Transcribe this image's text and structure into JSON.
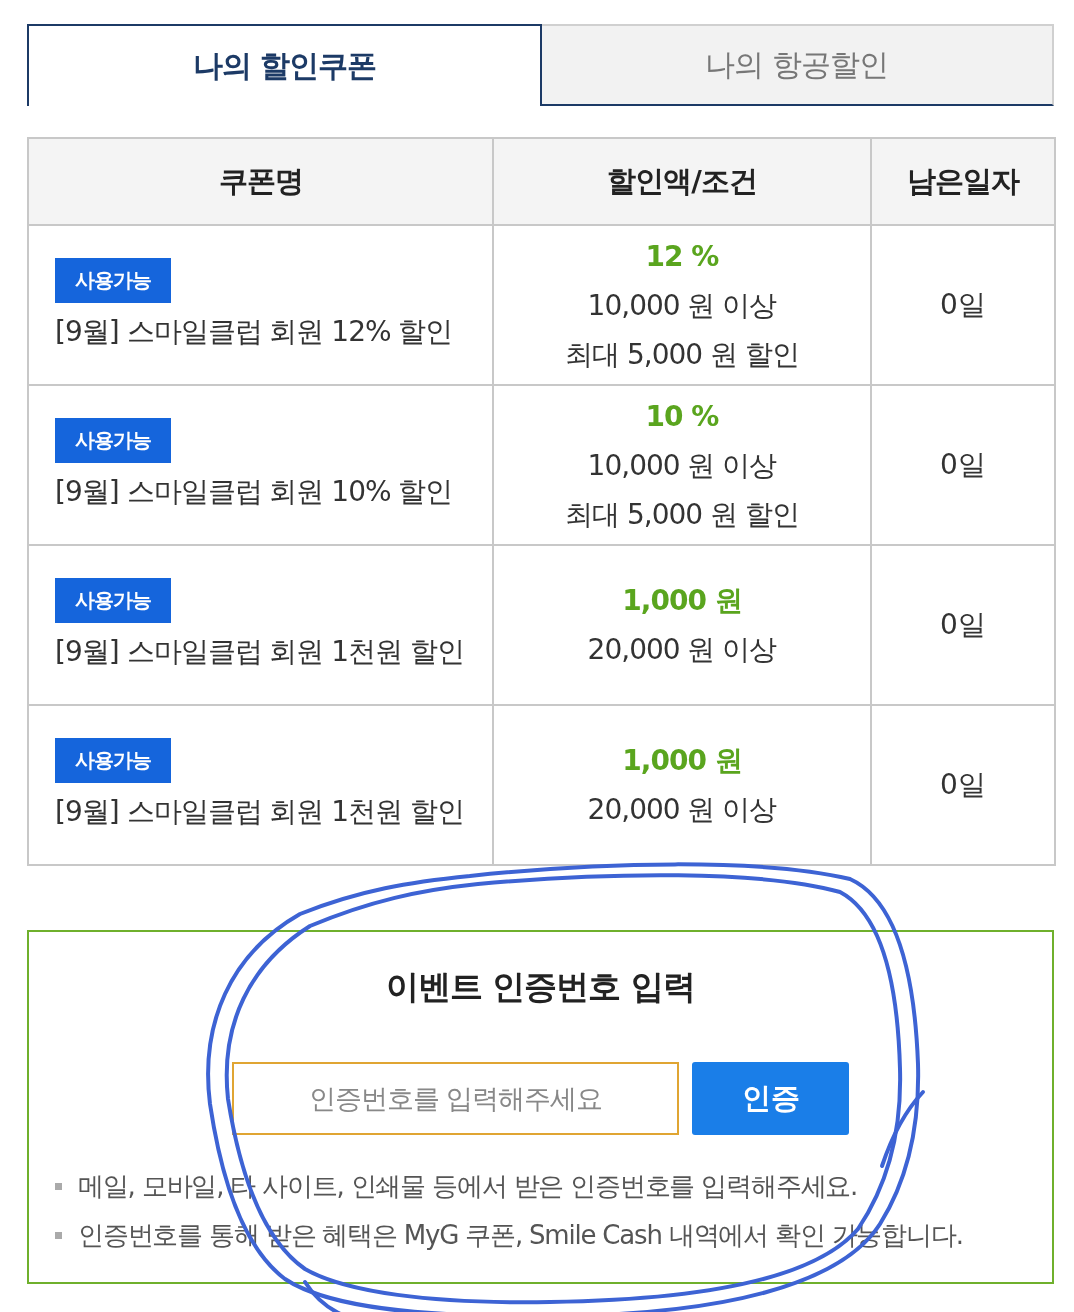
{
  "tabs": [
    {
      "label": "나의 할인쿠폰",
      "selected": true
    },
    {
      "label": "나의 항공할인",
      "selected": false
    }
  ],
  "table": {
    "columns": [
      "쿠폰명",
      "할인액/조건",
      "남은일자"
    ],
    "rows": [
      {
        "status": "사용가능",
        "name": "[9월] 스마일클럽 회원 12% 할인",
        "discount": "12 %",
        "conditions": [
          "10,000 원 이상",
          "최대 5,000 원 할인"
        ],
        "days_left": "0일"
      },
      {
        "status": "사용가능",
        "name": "[9월] 스마일클럽 회원 10% 할인",
        "discount": "10 %",
        "conditions": [
          "10,000 원 이상",
          "최대 5,000 원 할인"
        ],
        "days_left": "0일"
      },
      {
        "status": "사용가능",
        "name": "[9월] 스마일클럽 회원 1천원 할인",
        "discount": "1,000 원",
        "conditions": [
          "20,000 원 이상"
        ],
        "days_left": "0일"
      },
      {
        "status": "사용가능",
        "name": "[9월] 스마일클럽 회원 1천원 할인",
        "discount": "1,000 원",
        "conditions": [
          "20,000 원 이상"
        ],
        "days_left": "0일"
      }
    ]
  },
  "event_code": {
    "title": "이벤트 인증번호 입력",
    "input": {
      "placeholder": "인증번호를 입력해주세요"
    },
    "submit_button": "인증",
    "notes": [
      "메일, 모바일, 타 사이트, 인쇄물 등에서 받은 인증번호를 입력해주세요.",
      "인증번호를 통해 받은 혜택은 MyG 쿠폰, Smile Cash 내역에서 확인 가능합니다."
    ]
  }
}
